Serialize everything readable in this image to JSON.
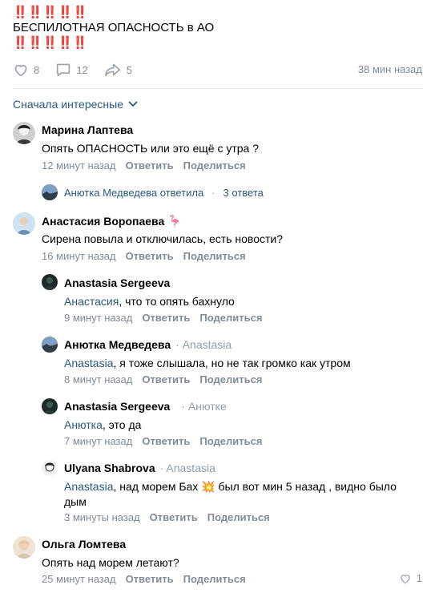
{
  "post": {
    "exclaim_top": "‼️‼️‼️‼️‼️",
    "text": "БЕСПИЛОТНАЯ ОПАСНОСТЬ в АО",
    "exclaim_bottom": "‼️‼️‼️‼️‼️",
    "likes": "8",
    "comments": "12",
    "shares": "5",
    "time": "38 мин назад"
  },
  "sort_label": "Сначала интересные",
  "comments": [
    {
      "name": "Марина Лаптева",
      "text": "Опять ОПАСНОСТЬ или это ещё с утра ?",
      "time": "12 минут назад",
      "reply": "Ответить",
      "share": "Поделиться",
      "summary_author": "Анютка Медведева ответила",
      "summary_count": "3 ответа"
    },
    {
      "name": "Анастасия Воропаева",
      "name_emoji": "🦩",
      "text": "Сирена повыла и отключилась, есть новости?",
      "time": "16 минут назад",
      "reply": "Ответить",
      "share": "Поделиться"
    },
    {
      "name": "Anastasia Sergeeva",
      "reply_to": "",
      "mention": "Анастасия",
      "text": ", что то опять бахнуло",
      "time": "9 минут назад",
      "reply": "Ответить",
      "share": "Поделиться"
    },
    {
      "name": "Анютка Медведева",
      "reply_to": "Anastasia",
      "mention": "Anastasia",
      "text": ", я тоже слышала, но не так громко как утром",
      "time": "8 минут назад",
      "reply": "Ответить",
      "share": "Поделиться"
    },
    {
      "name": "Anastasia Sergeeva",
      "reply_to": "Анютке",
      "mention": "Анютка",
      "text": ", это да",
      "time": "7 минут назад",
      "reply": "Ответить",
      "share": "Поделиться"
    },
    {
      "name": "Ulyana Shabrova",
      "reply_to": "Anastasia",
      "mention": "Anastasia",
      "text": ", над морем Бах 💥 был вот мин 5 назад , видно было дым",
      "time": "3 минуты назад",
      "reply": "Ответить",
      "share": "Поделиться"
    },
    {
      "name": "Ольга Ломтева",
      "text": "Опять над морем летают?",
      "time": "25 минут назад",
      "reply": "Ответить",
      "share": "Поделиться",
      "likes": "1"
    }
  ]
}
